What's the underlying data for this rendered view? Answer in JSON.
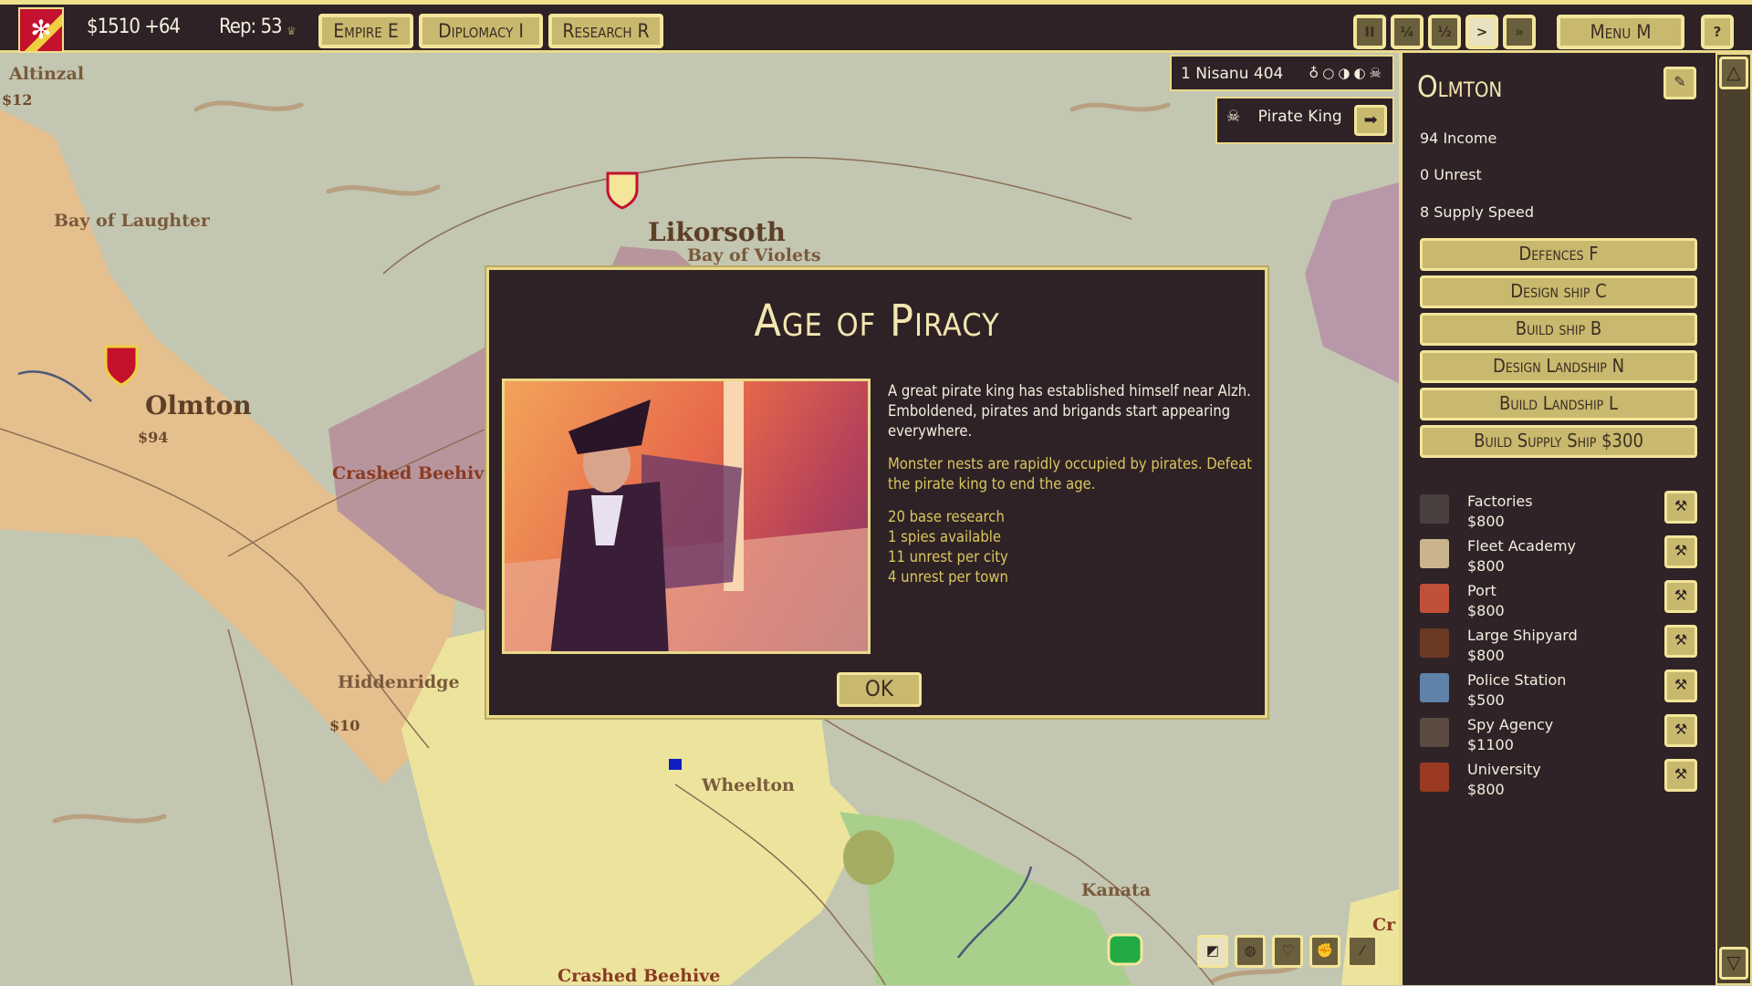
{
  "topbar": {
    "money": "$1510 +64",
    "reputation": "Rep: 53",
    "buttons": [
      "Empire E",
      "Diplomacy I",
      "Research R"
    ],
    "speed": [
      "II",
      "¼",
      "½",
      ">",
      "»"
    ],
    "menu": "Menu M",
    "help_icon": "help-book-icon"
  },
  "date": {
    "text": "1 Nisanu 404",
    "moons": "♁○◑◐☠"
  },
  "alert": {
    "label": "Pirate King",
    "icon": "skull-icon",
    "action": "➡"
  },
  "map": {
    "labels": [
      {
        "t": "Altinzal",
        "type": "normal"
      },
      {
        "t": "$12",
        "type": "money"
      },
      {
        "t": "Bay of Laughter",
        "type": "normal"
      },
      {
        "t": "Olmton",
        "type": "big"
      },
      {
        "t": "$94",
        "type": "money"
      },
      {
        "t": "Crashed Beehive",
        "type": "red"
      },
      {
        "t": "Hiddenridge",
        "type": "normal"
      },
      {
        "t": "$10",
        "type": "money"
      },
      {
        "t": "Likorsoth",
        "type": "big"
      },
      {
        "t": "Bay of Violets",
        "type": "normal"
      },
      {
        "t": "Wheelton",
        "type": "normal"
      },
      {
        "t": "Kanata",
        "type": "normal"
      },
      {
        "t": "Crashed Beehive",
        "type": "red"
      },
      {
        "t": "Cr",
        "type": "red"
      }
    ]
  },
  "dialog": {
    "title": "Age of Piracy",
    "description": "A great pirate king has established himself near Alzh. Emboldened, pirates and brigands start appearing everywhere.",
    "effect": "Monster nests are rapidly occupied by pirates. Defeat the pirate king to end the age.",
    "stats": [
      "20 base research",
      "1 spies available",
      "11 unrest per city",
      "4 unrest per town"
    ],
    "ok": "OK"
  },
  "panel": {
    "title": "Olmton",
    "stats": [
      "94 Income",
      "0 Unrest",
      "8 Supply Speed"
    ],
    "buttons": [
      "Defences F",
      "Design ship C",
      "Build ship B",
      "Design Landship N",
      "Build Landship L",
      "Build Supply Ship $300"
    ],
    "buildings": [
      {
        "name": "Factories",
        "cost": "$800",
        "icon": "factory-icon",
        "color": "#4a4040"
      },
      {
        "name": "Fleet Academy",
        "cost": "$800",
        "icon": "map-icon",
        "color": "#c9b48e"
      },
      {
        "name": "Port",
        "cost": "$800",
        "icon": "lighthouse-icon",
        "color": "#c0503a"
      },
      {
        "name": "Large Shipyard",
        "cost": "$800",
        "icon": "shipyard-icon",
        "color": "#6b3a22"
      },
      {
        "name": "Police Station",
        "cost": "$500",
        "icon": "shield-star-icon",
        "color": "#5f82a8"
      },
      {
        "name": "Spy Agency",
        "cost": "$1100",
        "icon": "crossed-daggers-icon",
        "color": "#5b4a40"
      },
      {
        "name": "University",
        "cost": "$800",
        "icon": "university-icon",
        "color": "#9a3a22"
      }
    ]
  },
  "colors": {
    "accent": "#f3e59a",
    "button": "#c8b96e",
    "panel": "#2e2226",
    "highlight_text": "#d9c65e"
  }
}
